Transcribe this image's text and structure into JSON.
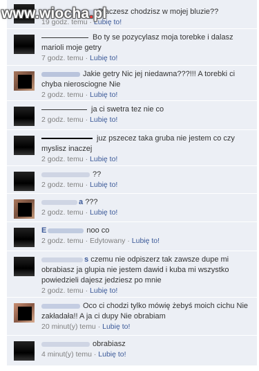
{
  "watermark": {
    "prefix": "www.",
    "brand": "wiocha",
    "dot": ".",
    "tld": "pl"
  },
  "like_label": "Lubię to!",
  "comments": [
    {
      "text": "Płaczesz chodzisz w mojej bluzie??",
      "time": "19 godz. temu"
    },
    {
      "text": "Bo ty se pozycylasz moja torebke i dalasz marioli moje getry",
      "time": "7 godz. temu"
    },
    {
      "text": "Jakie getry Nic jej niedawna???!!! A torebki ci chyba nierosciogne Nie",
      "time": "2 godz. temu"
    },
    {
      "text": "ja ci swetra tez nie co",
      "time": "2 godz. temu"
    },
    {
      "text": "juz pszecez taka gruba nie jestem co czy myslisz inaczej",
      "time": "2 godz. temu"
    },
    {
      "text": "??",
      "time": "2 godz. temu"
    },
    {
      "name_suffix": "a",
      "text": "???",
      "time": "2 godz. temu"
    },
    {
      "name_visible": "E",
      "text": "noo co",
      "time": "2 godz. temu",
      "edited": "Edytowany"
    },
    {
      "name_suffix": "s",
      "text": "czemu nie odpiszerz tak zawsze dupe mi obrabiasz ja glupia nie jestem dawid i kuba mi wszystko powiedzieli dajesz jedziesz po mnie",
      "time": "2 godz. temu"
    },
    {
      "text": "Oco ci chodzi tylko mówię żebyś moich cichu Nie zakładała!! A ja ci dupy Nie obrabiam",
      "time": "20 minut(y) temu"
    },
    {
      "text": "obrabiasz",
      "time": "4 minut(y) temu"
    }
  ]
}
